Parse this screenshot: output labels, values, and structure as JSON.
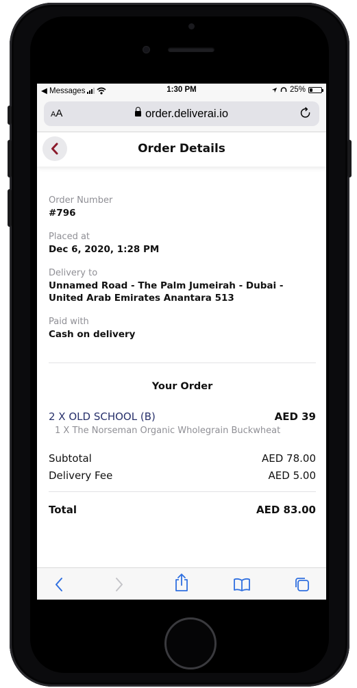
{
  "status_bar": {
    "back_app": "◀ Messages",
    "time": "1:30 PM",
    "battery": "25%",
    "battery_level": 0.25
  },
  "browser": {
    "aa": "AA",
    "url": "order.deliverai.io"
  },
  "header": {
    "title": "Order Details"
  },
  "order": {
    "number_label": "Order Number",
    "number": "#796",
    "placed_label": "Placed at",
    "placed": "Dec 6, 2020, 1:28 PM",
    "delivery_label": "Delivery to",
    "delivery": "Unnamed Road - The Palm Jumeirah - Dubai - United Arab Emirates Anantara 513",
    "paid_label": "Paid with",
    "paid": "Cash on delivery"
  },
  "your_order": {
    "title": "Your Order",
    "items": [
      {
        "name": "2 X OLD SCHOOL (B)",
        "price": "AED 39",
        "option": "1 X The Norseman Organic Wholegrain Buckwheat"
      }
    ],
    "subtotal_label": "Subtotal",
    "subtotal": "AED 78.00",
    "delivery_fee_label": "Delivery Fee",
    "delivery_fee": "AED 5.00",
    "total_label": "Total",
    "total": "AED 83.00"
  },
  "colors": {
    "accent": "#8b1a2b",
    "link": "#2f6fe0",
    "item_name": "#27306b"
  }
}
